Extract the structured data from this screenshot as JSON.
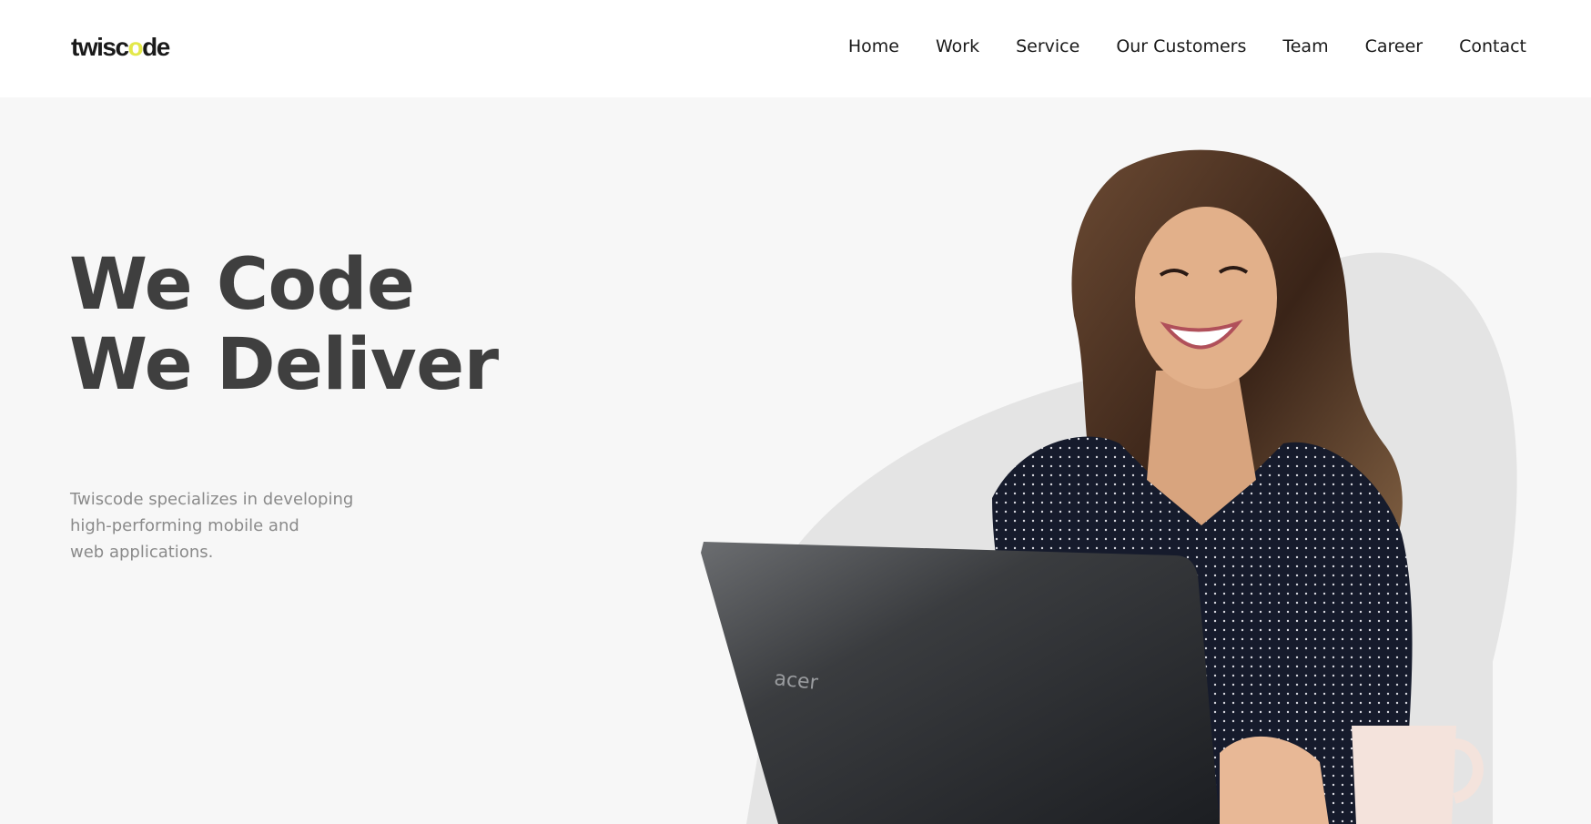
{
  "brand": {
    "logo_text_start": "twisc",
    "logo_text_accent": "o",
    "logo_text_end": "de",
    "accent_color": "#e3e84a"
  },
  "nav": {
    "items": [
      {
        "label": "Home"
      },
      {
        "label": "Work"
      },
      {
        "label": "Service"
      },
      {
        "label": "Our Customers"
      },
      {
        "label": "Team"
      },
      {
        "label": "Career"
      },
      {
        "label": "Contact"
      }
    ]
  },
  "hero": {
    "headline_line1": "We Code",
    "headline_line2": "We Deliver",
    "tagline_line1": "Twiscode specializes in developing",
    "tagline_line2": "high-performing mobile and",
    "tagline_line3": "web applications.",
    "laptop_brand": "acer"
  }
}
